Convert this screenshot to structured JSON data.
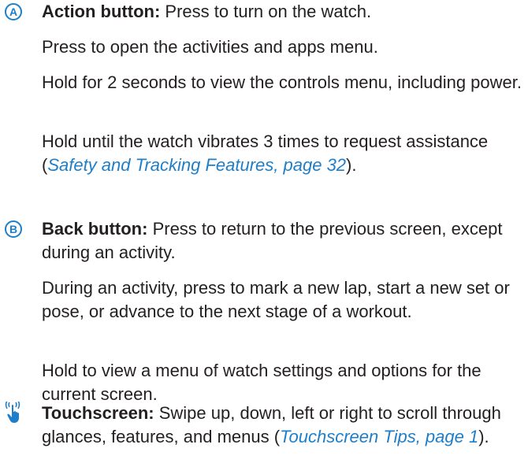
{
  "colors": {
    "text": "#231f20",
    "accent_blue": "#1f7ec8"
  },
  "items": [
    {
      "marker": "A",
      "term": "Action button:",
      "lead": " Press to turn on the watch.",
      "paragraphs": [
        "Press to open the activities and apps menu.",
        "Hold for 2 seconds to view the controls menu, including power."
      ],
      "last_paragraph": {
        "before": "Hold until the watch vibrates 3 times to request assistance (",
        "link": "Safety and Tracking Features, page 32",
        "after": ")."
      }
    },
    {
      "marker": "B",
      "term": "Back button:",
      "lead": " Press to return to the previous screen, except during an activity.",
      "paragraphs": [
        "During an activity, press to mark a new lap, start a new set or pose, or advance to the next stage of a workout.",
        "Hold to view a menu of watch settings and options for the current screen."
      ]
    },
    {
      "icon": "touchscreen-icon",
      "term": "Touchscreen:",
      "lead": " Swipe up, down, left or right to scroll through glances, features, and menus (",
      "link": "Touchscreen Tips, page 1",
      "after": ")."
    }
  ]
}
